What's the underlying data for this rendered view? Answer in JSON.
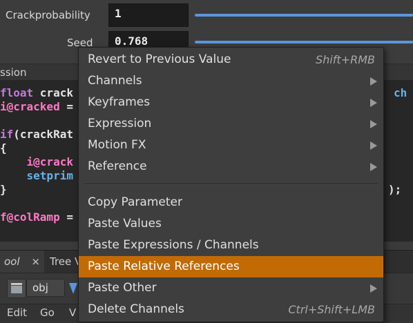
{
  "params": [
    {
      "label": "Crackprobability",
      "value": "1"
    },
    {
      "label": "Seed",
      "value": "0.768"
    }
  ],
  "section_label": "ssion",
  "code_lines": [
    {
      "tokens": [
        {
          "t": "float ",
          "c": "kw"
        },
        {
          "t": "crack",
          "c": "tx"
        }
      ]
    },
    {
      "tokens": [
        {
          "t": "i@cracked",
          "c": "at"
        },
        {
          "t": " =",
          "c": "tx"
        }
      ]
    },
    {
      "tokens": []
    },
    {
      "tokens": [
        {
          "t": "if",
          "c": "kw"
        },
        {
          "t": "(crackRat",
          "c": "tx"
        }
      ]
    },
    {
      "tokens": [
        {
          "t": "{",
          "c": "tx"
        }
      ]
    },
    {
      "tokens": [
        {
          "t": "    i@crack",
          "c": "at"
        }
      ]
    },
    {
      "tokens": [
        {
          "t": "    setprim",
          "c": "fn"
        }
      ]
    },
    {
      "tokens": [
        {
          "t": "}",
          "c": "tx"
        }
      ]
    },
    {
      "tokens": []
    },
    {
      "tokens": [
        {
          "t": "f@colRamp",
          "c": "at"
        },
        {
          "t": " =",
          "c": "tx"
        }
      ]
    }
  ],
  "code_right_fragments": {
    "top": "ch",
    "bottom": ");"
  },
  "tabs": {
    "first": "ool",
    "close": "×",
    "second": "Tree V"
  },
  "path": {
    "node": "obj"
  },
  "menubar": {
    "edit": "Edit",
    "go": "Go",
    "v": "V"
  },
  "menu": {
    "items": [
      {
        "label": "Revert to Previous Value",
        "shortcut": "Shift+RMB",
        "submenu": false
      },
      {
        "label": "Channels",
        "shortcut": "",
        "submenu": true
      },
      {
        "label": "Keyframes",
        "shortcut": "",
        "submenu": true
      },
      {
        "label": "Expression",
        "shortcut": "",
        "submenu": true
      },
      {
        "label": "Motion FX",
        "shortcut": "",
        "submenu": true
      },
      {
        "label": "Reference",
        "shortcut": "",
        "submenu": true
      },
      {
        "label": "Copy Parameter",
        "shortcut": "",
        "submenu": false
      },
      {
        "label": "Paste Values",
        "shortcut": "",
        "submenu": false
      },
      {
        "label": "Paste Expressions / Channels",
        "shortcut": "",
        "submenu": false
      },
      {
        "label": "Paste Relative References",
        "shortcut": "",
        "submenu": false,
        "highlighted": true
      },
      {
        "label": "Paste Other",
        "shortcut": "",
        "submenu": true
      },
      {
        "label": "Delete Channels",
        "shortcut": "Ctrl+Shift+LMB",
        "submenu": false
      }
    ]
  },
  "colors": {
    "highlight": "#c26b05",
    "slider": "#5b96dd"
  }
}
